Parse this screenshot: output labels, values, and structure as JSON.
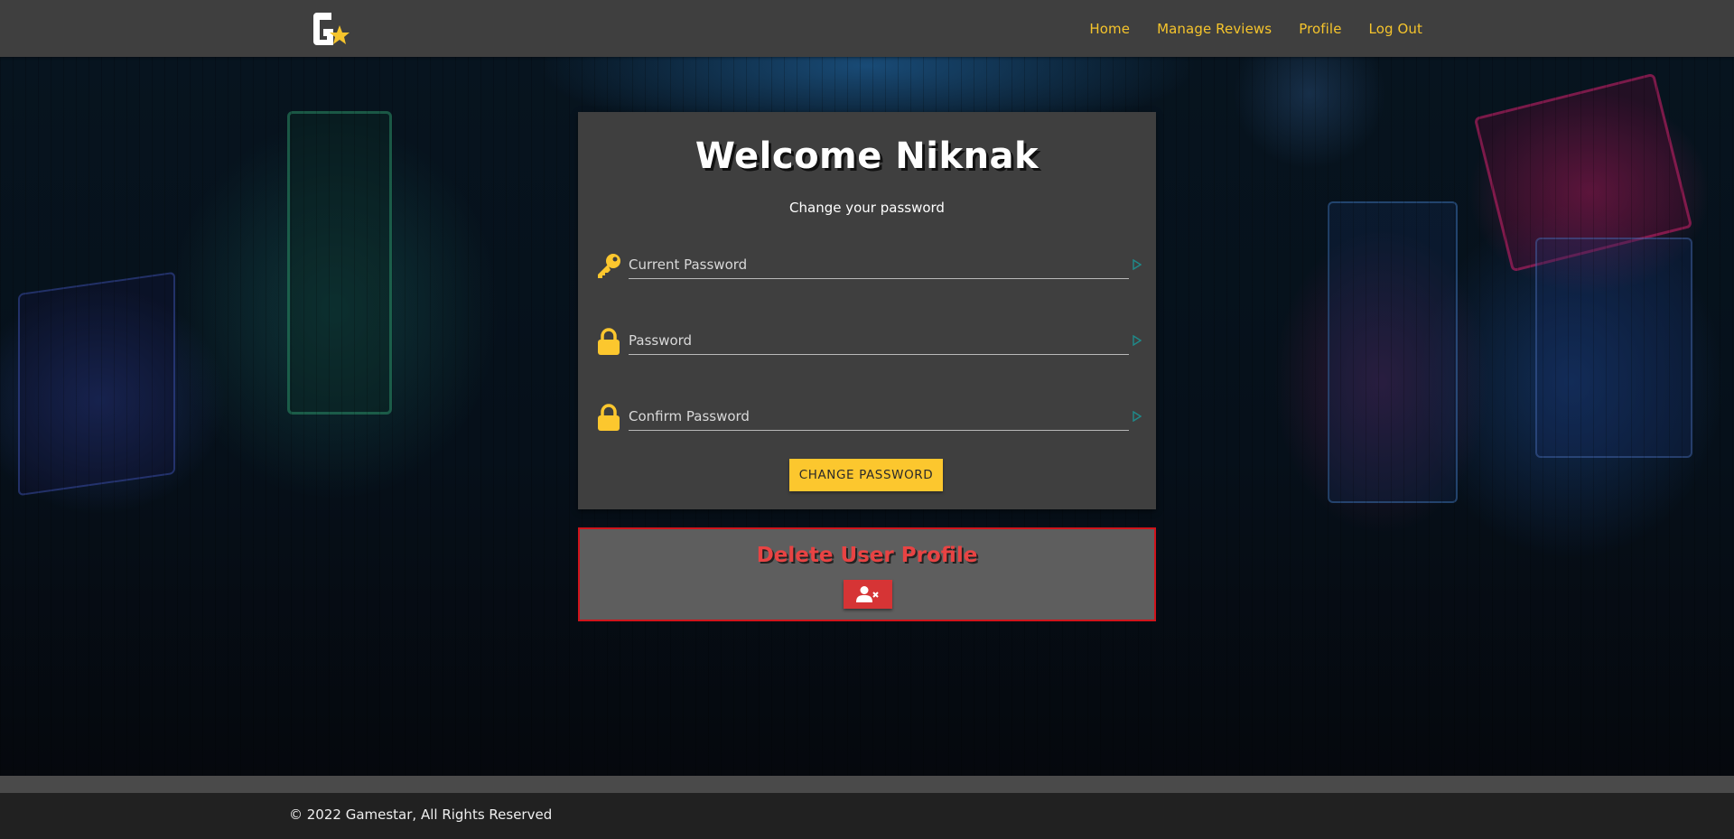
{
  "brand": {
    "logo_icon": "gamestar-logo-icon",
    "accent": "#f5c42c"
  },
  "nav": {
    "links": [
      {
        "label": "Home"
      },
      {
        "label": "Manage Reviews"
      },
      {
        "label": "Profile"
      },
      {
        "label": "Log Out"
      }
    ]
  },
  "main": {
    "welcome": "Welcome Niknak",
    "subtitle": "Change your password",
    "fields": [
      {
        "placeholder": "Current Password",
        "icon": "key-icon",
        "value": ""
      },
      {
        "placeholder": "Password",
        "icon": "lock-icon",
        "value": ""
      },
      {
        "placeholder": "Confirm Password",
        "icon": "lock-icon",
        "value": ""
      }
    ],
    "change_button": "CHANGE PASSWORD"
  },
  "delete": {
    "title": "Delete User Profile",
    "button_icon": "user-remove-icon",
    "border_color": "#d0141b"
  },
  "footer": {
    "text": "© 2022 Gamestar, All Rights Reserved"
  }
}
